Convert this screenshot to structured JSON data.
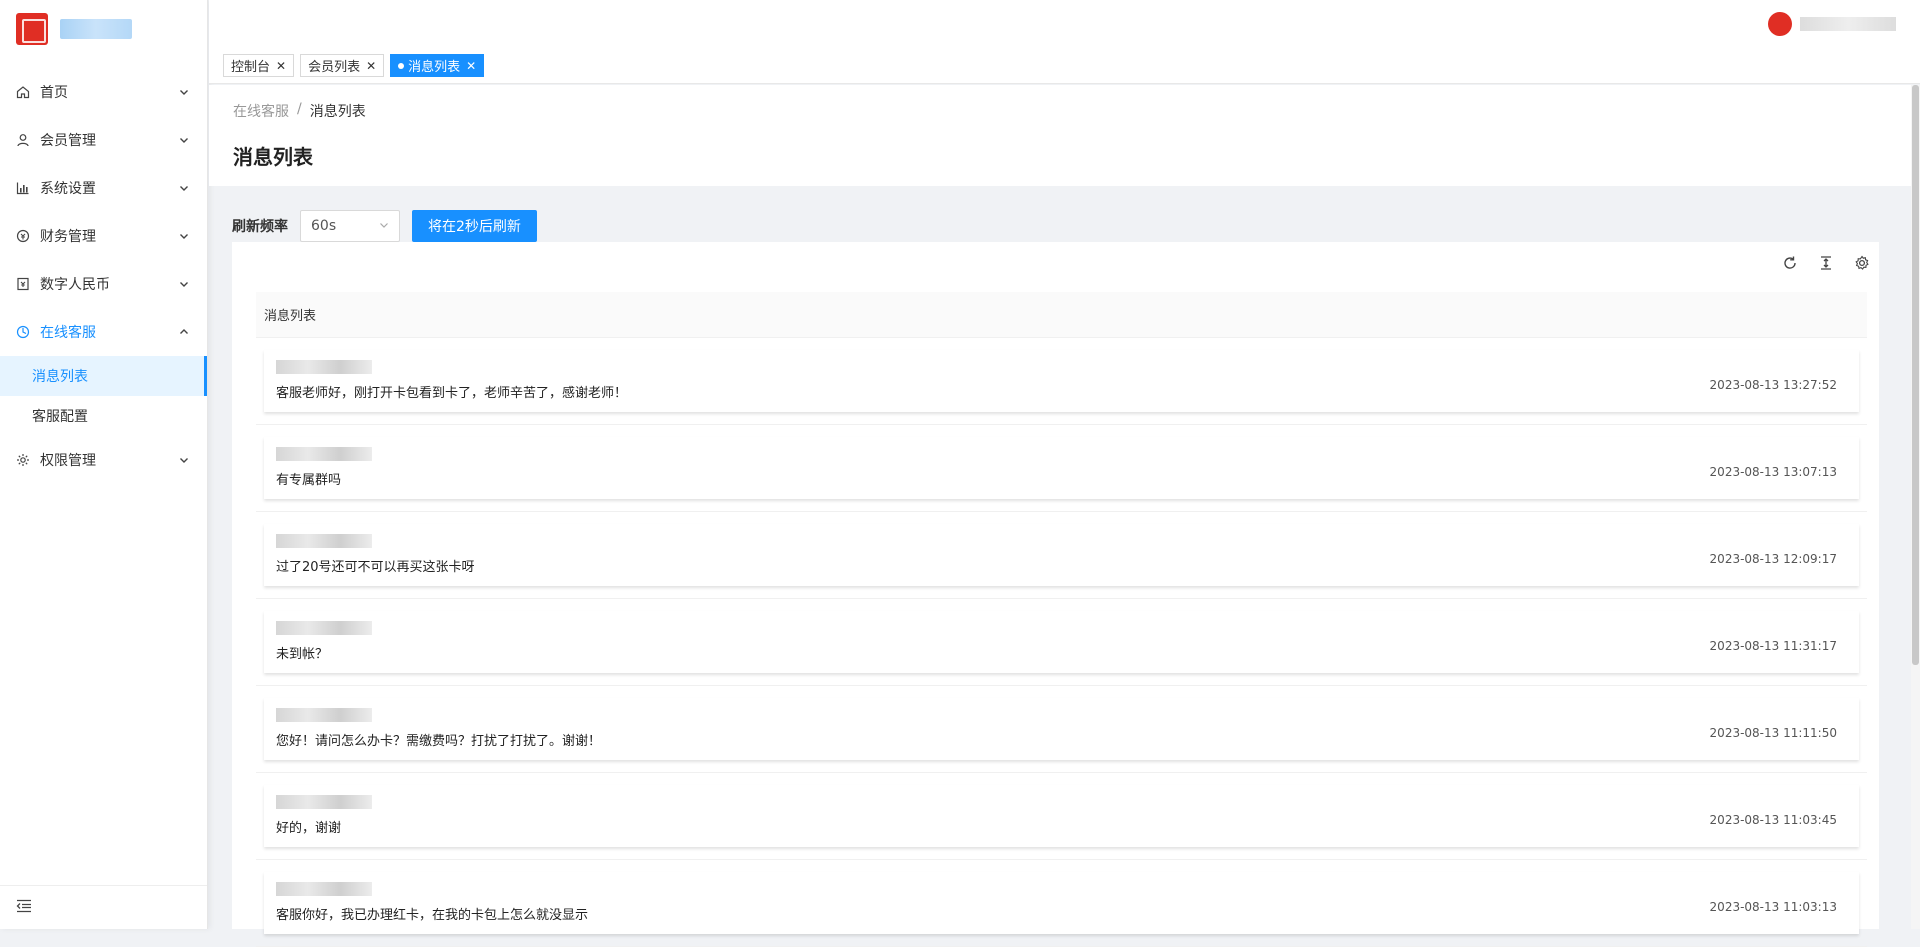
{
  "sidebar": {
    "menu": [
      {
        "label": "首页",
        "icon": "home-icon"
      },
      {
        "label": "会员管理",
        "icon": "user-icon"
      },
      {
        "label": "系统设置",
        "icon": "bar-chart-icon"
      },
      {
        "label": "财务管理",
        "icon": "finance-icon"
      },
      {
        "label": "数字人民币",
        "icon": "wallet-icon"
      },
      {
        "label": "在线客服",
        "icon": "service-icon"
      },
      {
        "label": "权限管理",
        "icon": "gear-icon"
      }
    ],
    "submenu": [
      {
        "label": "消息列表"
      },
      {
        "label": "客服配置"
      }
    ]
  },
  "tabs": [
    {
      "label": "控制台"
    },
    {
      "label": "会员列表"
    },
    {
      "label": "消息列表"
    }
  ],
  "breadcrumb": {
    "parent": "在线客服",
    "separator": "/",
    "current": "消息列表"
  },
  "page_title": "消息列表",
  "toolbar": {
    "refresh_label": "刷新频率",
    "refresh_value": "60s",
    "refresh_button": "将在2秒后刷新"
  },
  "list": {
    "header": "消息列表",
    "messages": [
      {
        "text": "客服老师好，刚打开卡包看到卡了，老师辛苦了，感谢老师！",
        "time": "2023-08-13 13:27:52"
      },
      {
        "text": "有专属群吗",
        "time": "2023-08-13 13:07:13"
      },
      {
        "text": "过了20号还可不可以再买这张卡呀",
        "time": "2023-08-13 12:09:17"
      },
      {
        "text": "未到帐？",
        "time": "2023-08-13 11:31:17"
      },
      {
        "text": "您好！请问怎么办卡？需缴费吗？打扰了打扰了。谢谢！",
        "time": "2023-08-13 11:11:50"
      },
      {
        "text": "好的，谢谢",
        "time": "2023-08-13 11:03:45"
      },
      {
        "text": "客服你好，我已办理红卡，在我的卡包上怎么就没显示",
        "time": "2023-08-13 11:03:13"
      }
    ]
  },
  "colors": {
    "primary": "#1890ff",
    "brand": "#e02e24"
  }
}
